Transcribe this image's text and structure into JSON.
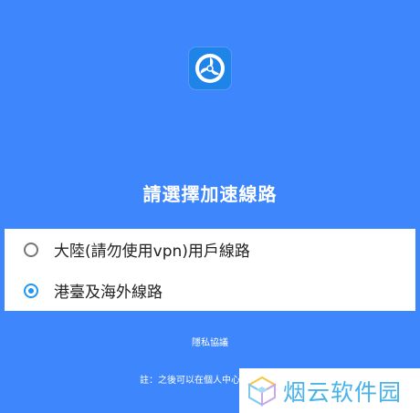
{
  "header": {
    "app_icon": "shield-fan-icon",
    "title": "請選擇加速線路"
  },
  "route_options": [
    {
      "label": "大陸(請勿使用vpn)用戶線路",
      "selected": false
    },
    {
      "label": "港臺及海外線路",
      "selected": true
    }
  ],
  "footer": {
    "privacy_link": "隱私協議",
    "note": "註：之後可以在個人中心"
  },
  "watermark": {
    "text": "烟云软件园",
    "logo": "cube-logo-icon"
  },
  "colors": {
    "background": "#3d86fb",
    "accent": "#2196f3",
    "watermark_text": "#4ab3e8"
  }
}
